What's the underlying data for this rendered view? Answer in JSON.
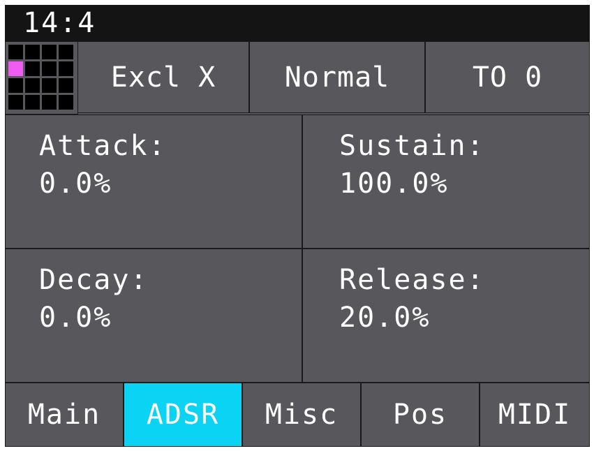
{
  "status_bar": {
    "time": "14:4"
  },
  "pad_grid": {
    "rows": 4,
    "cols": 4,
    "active_pad_row": 2,
    "active_pad_col": 1,
    "active_color": "#ee5cf2"
  },
  "top_buttons": {
    "exclusive": "Excl X",
    "mode": "Normal",
    "output": "TO 0"
  },
  "params": {
    "attack": {
      "label": "Attack:",
      "value": "0.0%"
    },
    "sustain": {
      "label": "Sustain:",
      "value": "100.0%"
    },
    "decay": {
      "label": "Decay:",
      "value": "0.0%"
    },
    "release": {
      "label": "Release:",
      "value": "20.0%"
    }
  },
  "tabs": [
    {
      "label": "Main",
      "active": false
    },
    {
      "label": "ADSR",
      "active": true
    },
    {
      "label": "Misc",
      "active": false
    },
    {
      "label": "Pos",
      "active": false
    },
    {
      "label": "MIDI",
      "active": false
    }
  ],
  "colors": {
    "background": "#58585c",
    "status_bar": "#141414",
    "active_tab": "#0bd3f4",
    "text": "#ffffff"
  }
}
